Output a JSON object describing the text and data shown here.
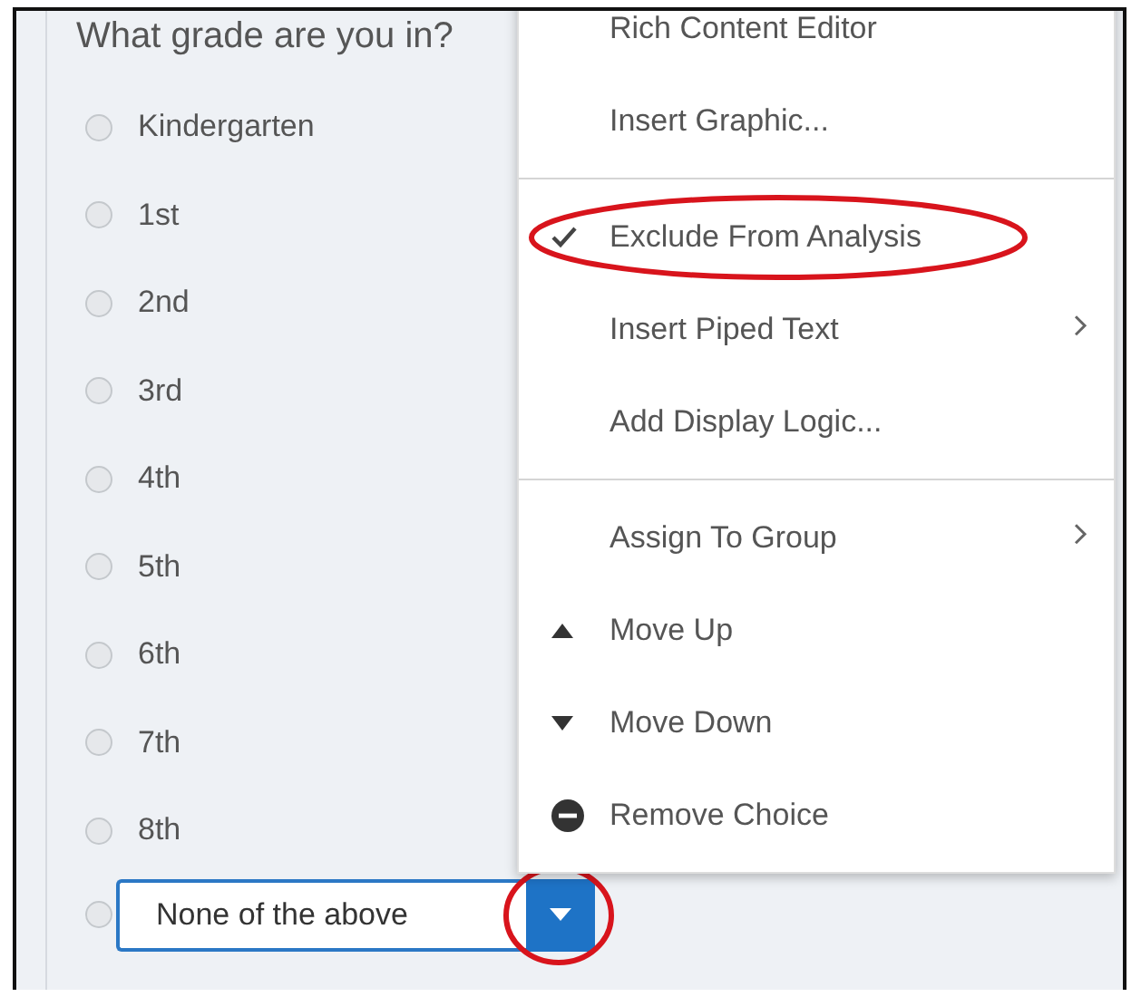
{
  "question": "What grade are you in?",
  "choices": [
    {
      "label": "Kindergarten",
      "selected": false
    },
    {
      "label": "1st",
      "selected": false
    },
    {
      "label": "2nd",
      "selected": false
    },
    {
      "label": "3rd",
      "selected": false
    },
    {
      "label": "4th",
      "selected": false
    },
    {
      "label": "5th",
      "selected": false
    },
    {
      "label": "6th",
      "selected": false
    },
    {
      "label": "7th",
      "selected": false
    },
    {
      "label": "8th",
      "selected": false
    }
  ],
  "editing_choice": {
    "value": "None of the above",
    "selected": false,
    "dropdown_circled": true
  },
  "menu": {
    "groups": [
      [
        {
          "label": "Rich Content Editor",
          "kind": "plain",
          "submenu": false,
          "checked": false,
          "circled": false
        },
        {
          "label": "Insert Graphic...",
          "kind": "plain",
          "submenu": false,
          "checked": false,
          "circled": false
        }
      ],
      [
        {
          "label": "Exclude From Analysis",
          "kind": "plain",
          "submenu": false,
          "checked": true,
          "circled": true
        },
        {
          "label": "Insert Piped Text",
          "kind": "plain",
          "submenu": true,
          "checked": false,
          "circled": false
        },
        {
          "label": "Add Display Logic...",
          "kind": "plain",
          "submenu": false,
          "checked": false,
          "circled": false
        }
      ],
      [
        {
          "label": "Assign To Group",
          "kind": "plain",
          "submenu": true,
          "checked": false,
          "circled": false
        },
        {
          "label": "Move Up",
          "kind": "move_up",
          "submenu": false,
          "checked": false,
          "circled": false
        },
        {
          "label": "Move Down",
          "kind": "move_down",
          "submenu": false,
          "checked": false,
          "circled": false
        },
        {
          "label": "Remove Choice",
          "kind": "remove",
          "submenu": false,
          "checked": false,
          "circled": false
        }
      ]
    ]
  }
}
